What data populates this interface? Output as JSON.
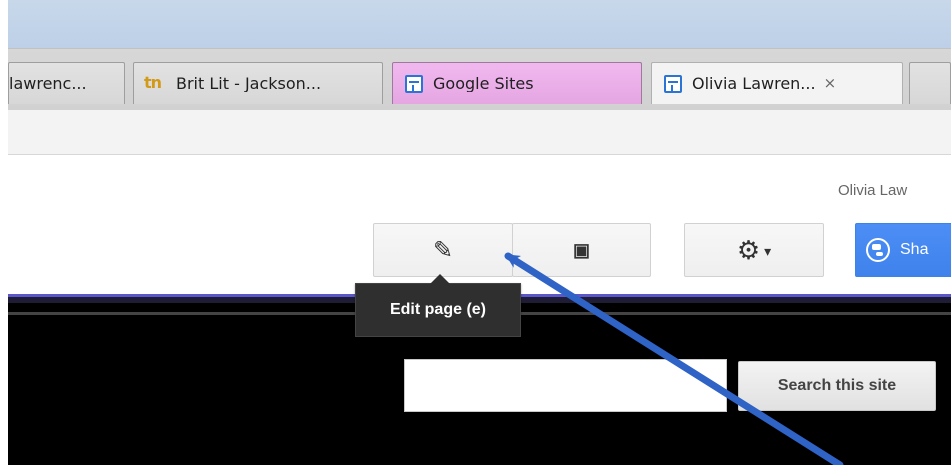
{
  "browser": {
    "tabs": [
      {
        "title": "lawrenc..."
      },
      {
        "title": "Brit Lit - Jackson...",
        "icon": "brand-icon"
      },
      {
        "title": "Google Sites",
        "icon": "doc-icon"
      },
      {
        "title": "Olivia Lawren...",
        "icon": "doc-icon",
        "close": "×"
      }
    ]
  },
  "header": {
    "user": "Olivia Law"
  },
  "toolbar": {
    "edit_icon": "✎",
    "new_page_icon": "▣",
    "more_icon": "⚙",
    "chevron": "▾",
    "share_label": "Sha"
  },
  "tooltip": {
    "text": "Edit page (e)"
  },
  "search": {
    "value": "",
    "placeholder": "",
    "button_label": "Search this site"
  },
  "colors": {
    "title_bar": "#c8d8ea",
    "tab_pink": "#f1b8ef",
    "share_blue": "#4c8ef6",
    "site_band": "#000000",
    "arrow": "#2f63c6"
  }
}
